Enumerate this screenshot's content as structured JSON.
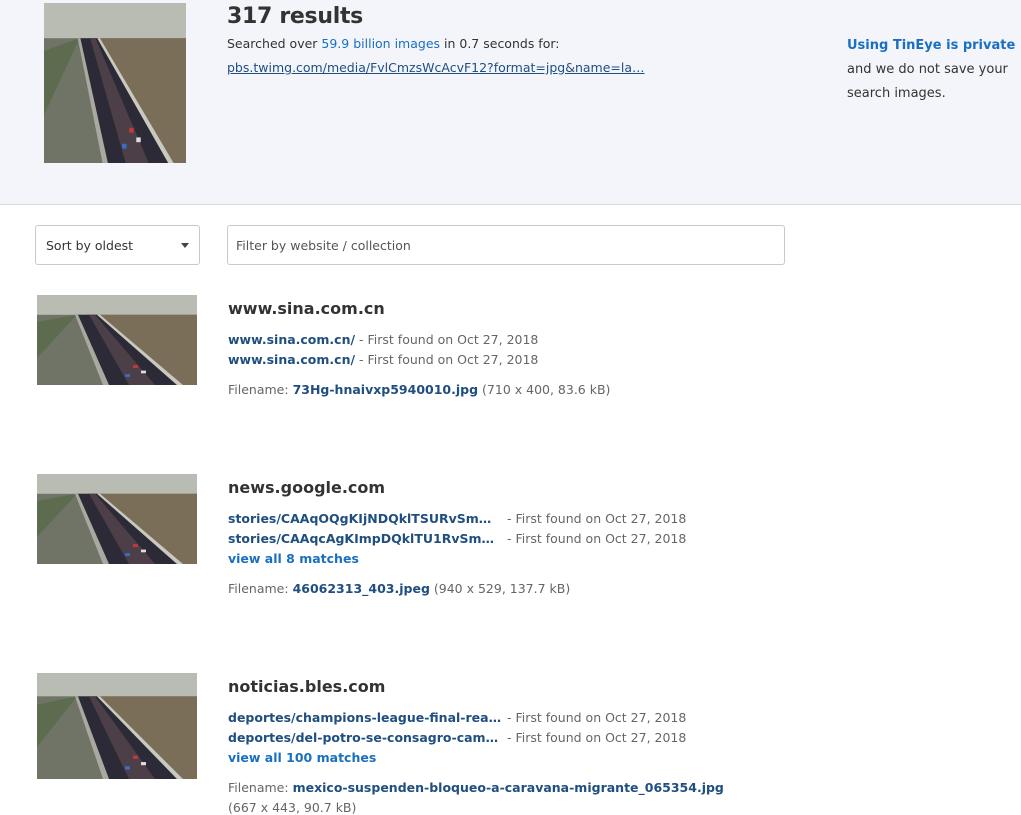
{
  "header": {
    "results_count": "317 results",
    "searched_prefix": "Searched over",
    "searched_highlight": "59.9 billion images",
    "searched_suffix": "in 0.7 seconds for:",
    "query_url": "pbs.twimg.com/media/FvlCmzsWcAcvF12?format=jpg&name=la…",
    "privacy_link": "Using TinEye is private",
    "privacy_text": "and we do not save your search images."
  },
  "controls": {
    "sort_value": "Sort by oldest",
    "filter_placeholder": "Filter by website / collection"
  },
  "labels": {
    "filename": "Filename:"
  },
  "results": [
    {
      "domain": "www.sina.com.cn",
      "matches": [
        {
          "link": "www.sina.com.cn/",
          "found": "- First found on Oct 27, 2018"
        },
        {
          "link": "www.sina.com.cn/",
          "found": "- First found on Oct 27, 2018"
        }
      ],
      "filename": "73Hg-hnaivxp5940010.jpg",
      "fileinfo": "(710 x 400, 83.6 kB)"
    },
    {
      "domain": "news.google.com",
      "matches": [
        {
          "link": "stories/CAAqOQgKIjNDQklTSURvSmMz...",
          "found": "- First found on Oct 27, 2018"
        },
        {
          "link": "stories/CAAqcAgKImpDQklTU1RvSmMz...",
          "found": "- First found on Oct 27, 2018"
        }
      ],
      "view_all": "view all 8 matches",
      "filename": "46062313_403.jpeg",
      "fileinfo": "(940 x 529, 137.7 kB)"
    },
    {
      "domain": "noticias.bles.com",
      "matches": [
        {
          "link": "deportes/champions-league-final-real-...",
          "found": "- First found on Oct 27, 2018"
        },
        {
          "link": "deportes/del-potro-se-consagro-campe...",
          "found": "- First found on Oct 27, 2018"
        }
      ],
      "view_all": "view all 100 matches",
      "filename": "mexico-suspenden-bloqueo-a-caravana-migrante_065354.jpg",
      "fileinfo": "(667 x 443, 90.7 kB)"
    }
  ]
}
